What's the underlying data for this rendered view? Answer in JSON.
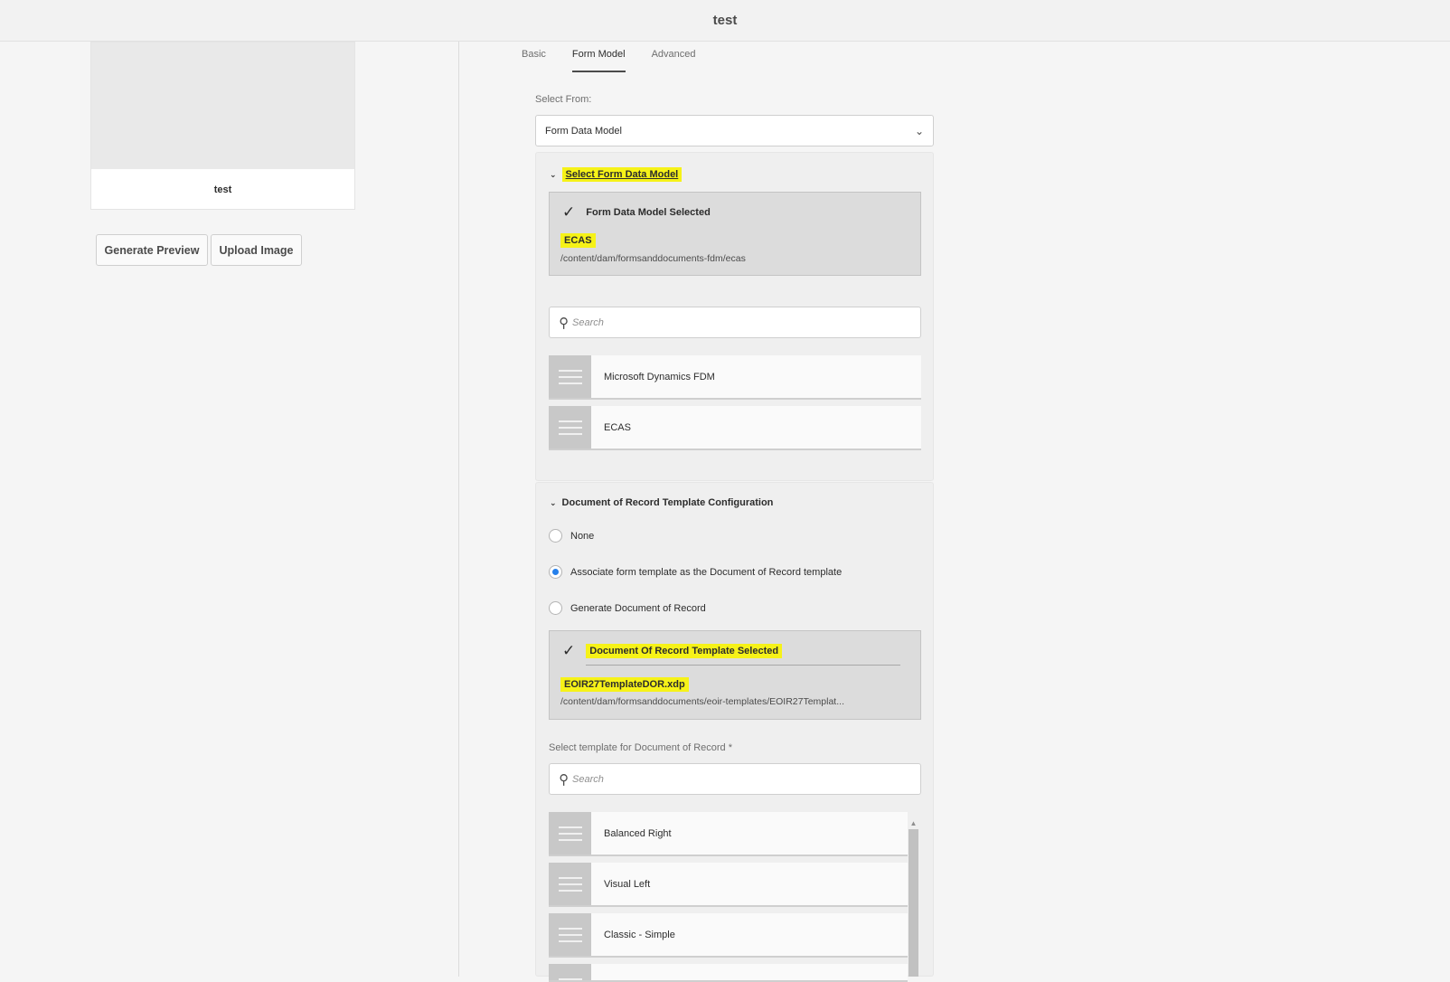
{
  "header": {
    "title": "test"
  },
  "left": {
    "thumbnail_label": "test",
    "generate_preview": "Generate Preview",
    "upload_image": "Upload Image"
  },
  "tabs": [
    "Basic",
    "Form Model",
    "Advanced"
  ],
  "select_from": {
    "label": "Select From:",
    "value": "Form Data Model"
  },
  "fdm_section": {
    "heading": "Select Form Data Model",
    "selected_title": "Form Data Model Selected",
    "selected_name": "ECAS",
    "selected_path": "/content/dam/formsanddocuments-fdm/ecas",
    "search_placeholder": "Search",
    "items": [
      "Microsoft Dynamics FDM",
      "ECAS"
    ]
  },
  "dor_section": {
    "heading": "Document of Record Template Configuration",
    "options": [
      "None",
      "Associate form template as the Document of Record template",
      "Generate Document of Record"
    ],
    "selected_option_index": 1,
    "selected_title": "Document Of Record Template Selected",
    "selected_name": "EOIR27TemplateDOR.xdp",
    "selected_path": "/content/dam/formsanddocuments/eoir-templates/EOIR27Templat...",
    "template_label": "Select template for Document of Record *",
    "search_placeholder": "Search",
    "items": [
      "Balanced Right",
      "Visual Left",
      "Classic - Simple"
    ]
  },
  "colors": {
    "highlight": "#f6f218",
    "radio_selected": "#2680eb"
  }
}
